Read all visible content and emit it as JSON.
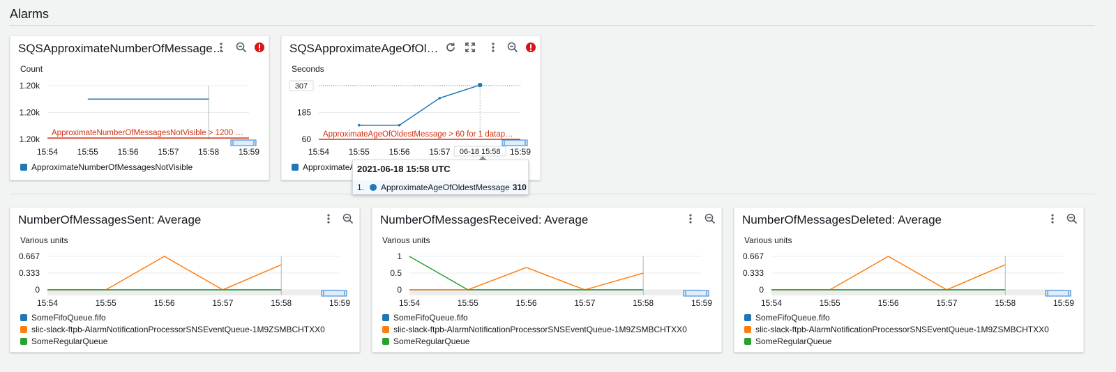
{
  "page": {
    "title": "Alarms"
  },
  "colors": {
    "blue": "#1f77b4",
    "orange": "#ff7f0e",
    "green": "#2ca02c",
    "alarm": "#d13212",
    "error": "#d91515"
  },
  "widgets": [
    {
      "title": "SQSApproximateNumberOfMessagesNotVisible",
      "title_display": "SQSApproximateNumberOfMessages…",
      "unit": "Count",
      "icons": [
        "more-icon",
        "zoom-out-icon",
        "alarm-error-icon"
      ],
      "legend": [
        {
          "name": "ApproximateNumberOfMessagesNotVisible",
          "color": "#1f77b4"
        }
      ]
    },
    {
      "title": "SQSApproximateAgeOfOldestMessage",
      "title_display": "SQSApproximateAgeOfOl…",
      "unit": "Seconds",
      "icons": [
        "refresh-icon",
        "expand-icon",
        "more-icon",
        "zoom-out-icon",
        "alarm-error-icon"
      ],
      "legend": [
        {
          "name": "ApproximateA",
          "color": "#1f77b4"
        }
      ],
      "hover_x_label": "06-18 15:58",
      "hover_y_label": "307"
    },
    {
      "title": "NumberOfMessagesSent: Average",
      "unit": "Various units",
      "icons": [
        "more-icon",
        "zoom-out-icon"
      ],
      "legend": [
        {
          "name": "SomeFifoQueue.fifo",
          "color": "#1f77b4"
        },
        {
          "name": "slic-slack-ftpb-AlarmNotificationProcessorSNSEventQueue-1M9ZSMBCHTXX0",
          "color": "#ff7f0e"
        },
        {
          "name": "SomeRegularQueue",
          "color": "#2ca02c"
        }
      ]
    },
    {
      "title": "NumberOfMessagesReceived: Average",
      "unit": "Various units",
      "icons": [
        "more-icon",
        "zoom-out-icon"
      ],
      "legend": [
        {
          "name": "SomeFifoQueue.fifo",
          "color": "#1f77b4"
        },
        {
          "name": "slic-slack-ftpb-AlarmNotificationProcessorSNSEventQueue-1M9ZSMBCHTXX0",
          "color": "#ff7f0e"
        },
        {
          "name": "SomeRegularQueue",
          "color": "#2ca02c"
        }
      ]
    },
    {
      "title": "NumberOfMessagesDeleted: Average",
      "unit": "Various units",
      "icons": [
        "more-icon",
        "zoom-out-icon"
      ],
      "legend": [
        {
          "name": "SomeFifoQueue.fifo",
          "color": "#1f77b4"
        },
        {
          "name": "slic-slack-ftpb-AlarmNotificationProcessorSNSEventQueue-1M9ZSMBCHTXX0",
          "color": "#ff7f0e"
        },
        {
          "name": "SomeRegularQueue",
          "color": "#2ca02c"
        }
      ]
    }
  ],
  "tooltip": {
    "header": "2021-06-18 15:58 UTC",
    "index": "1.",
    "series": "ApproximateAgeOfOldestMessage",
    "value": "310"
  },
  "chart_data": [
    {
      "type": "line",
      "x": [
        "15:54",
        "15:55",
        "15:56",
        "15:57",
        "15:58",
        "15:59"
      ],
      "yticks": [
        "1.20k",
        "1.20k",
        "1.20k"
      ],
      "ylim": [
        1199,
        1201
      ],
      "series": [
        {
          "name": "ApproximateNumberOfMessagesNotVisible",
          "color": "#1f77b4",
          "points": [
            [
              "15:55",
              1200.5
            ],
            [
              "15:56",
              1200.5
            ],
            [
              "15:57",
              1200.5
            ],
            [
              "15:58",
              1200.5
            ]
          ]
        }
      ],
      "threshold": {
        "label": "ApproximateNumberOfMessagesNotVisible > 1200 …",
        "value": 1199.05
      },
      "grid": true
    },
    {
      "type": "line",
      "x": [
        "15:54",
        "15:55",
        "15:56",
        "15:57",
        "15:58",
        "15:59"
      ],
      "yticks": [
        "60",
        "185",
        "307"
      ],
      "ylim": [
        60,
        307
      ],
      "series": [
        {
          "name": "ApproximateAgeOfOldestMessage",
          "color": "#1f77b4",
          "points": [
            [
              "15:55",
              125
            ],
            [
              "15:56",
              125
            ],
            [
              "15:57",
              250
            ],
            [
              "15:58",
              310
            ]
          ]
        }
      ],
      "threshold": {
        "label": "ApproximateAgeOfOldestMessage > 60 for 1 datap…",
        "value": 60
      },
      "grid": true
    },
    {
      "type": "line",
      "x": [
        "15:54",
        "15:55",
        "15:56",
        "15:57",
        "15:58",
        "15:59"
      ],
      "yticks": [
        "0",
        "0.333",
        "0.667"
      ],
      "ylim": [
        0,
        0.667
      ],
      "series": [
        {
          "name": "SomeFifoQueue.fifo",
          "color": "#1f77b4",
          "points": [
            [
              "15:54",
              0
            ],
            [
              "15:55",
              0
            ],
            [
              "15:56",
              0
            ],
            [
              "15:57",
              0
            ],
            [
              "15:58",
              0
            ]
          ]
        },
        {
          "name": "slic-slack-ftpb-AlarmNotificationProcessorSNSEventQueue-1M9ZSMBCHTXX0",
          "color": "#ff7f0e",
          "points": [
            [
              "15:54",
              0
            ],
            [
              "15:55",
              0
            ],
            [
              "15:56",
              0.667
            ],
            [
              "15:57",
              0
            ],
            [
              "15:58",
              0.5
            ]
          ]
        },
        {
          "name": "SomeRegularQueue",
          "color": "#2ca02c",
          "points": [
            [
              "15:54",
              0
            ],
            [
              "15:55",
              0
            ],
            [
              "15:56",
              0
            ],
            [
              "15:57",
              0
            ],
            [
              "15:58",
              0
            ]
          ]
        }
      ],
      "grid": true
    },
    {
      "type": "line",
      "x": [
        "15:54",
        "15:55",
        "15:56",
        "15:57",
        "15:58",
        "15:59"
      ],
      "yticks": [
        "0",
        "0.5",
        "1"
      ],
      "ylim": [
        0,
        1
      ],
      "series": [
        {
          "name": "SomeFifoQueue.fifo",
          "color": "#1f77b4",
          "points": [
            [
              "15:54",
              0
            ],
            [
              "15:55",
              0
            ],
            [
              "15:56",
              0
            ],
            [
              "15:57",
              0
            ],
            [
              "15:58",
              0
            ]
          ]
        },
        {
          "name": "slic-slack-ftpb-AlarmNotificationProcessorSNSEventQueue-1M9ZSMBCHTXX0",
          "color": "#ff7f0e",
          "points": [
            [
              "15:54",
              0
            ],
            [
              "15:55",
              0
            ],
            [
              "15:56",
              0.667
            ],
            [
              "15:57",
              0
            ],
            [
              "15:58",
              0.5
            ]
          ]
        },
        {
          "name": "SomeRegularQueue",
          "color": "#2ca02c",
          "points": [
            [
              "15:54",
              1
            ],
            [
              "15:55",
              0
            ],
            [
              "15:56",
              0
            ],
            [
              "15:57",
              0
            ],
            [
              "15:58",
              0
            ]
          ]
        }
      ],
      "grid": true
    },
    {
      "type": "line",
      "x": [
        "15:54",
        "15:55",
        "15:56",
        "15:57",
        "15:58",
        "15:59"
      ],
      "yticks": [
        "0",
        "0.333",
        "0.667"
      ],
      "ylim": [
        0,
        0.667
      ],
      "series": [
        {
          "name": "SomeFifoQueue.fifo",
          "color": "#1f77b4",
          "points": [
            [
              "15:54",
              0
            ],
            [
              "15:55",
              0
            ],
            [
              "15:56",
              0
            ],
            [
              "15:57",
              0
            ],
            [
              "15:58",
              0
            ]
          ]
        },
        {
          "name": "slic-slack-ftpb-AlarmNotificationProcessorSNSEventQueue-1M9ZSMBCHTXX0",
          "color": "#ff7f0e",
          "points": [
            [
              "15:54",
              0
            ],
            [
              "15:55",
              0
            ],
            [
              "15:56",
              0.667
            ],
            [
              "15:57",
              0
            ],
            [
              "15:58",
              0.5
            ]
          ]
        },
        {
          "name": "SomeRegularQueue",
          "color": "#2ca02c",
          "points": [
            [
              "15:54",
              0
            ],
            [
              "15:55",
              0
            ],
            [
              "15:56",
              0
            ],
            [
              "15:57",
              0
            ],
            [
              "15:58",
              0
            ]
          ]
        }
      ],
      "grid": true
    }
  ]
}
